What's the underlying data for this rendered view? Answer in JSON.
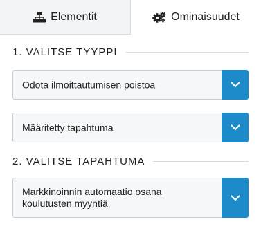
{
  "tabs": [
    {
      "label": "Elementit",
      "icon": "sitemap-icon",
      "active": false
    },
    {
      "label": "Ominaisuudet",
      "icon": "gears-icon",
      "active": true
    }
  ],
  "sections": [
    {
      "title": "1. VALITSE TYYPPI"
    },
    {
      "title": "2. VALITSE TAPAHTUMA"
    }
  ],
  "selects": {
    "type": {
      "value": "Odota ilmoittautumisen poistoa"
    },
    "event_kind": {
      "value": "Määritetty tapahtuma"
    },
    "event": {
      "value": "Markkinoinnin automaatio osana koulutusten myyntiä"
    }
  },
  "colors": {
    "accent": "#1d8bc9",
    "inactive_tab_bg": "#f3f4f5",
    "select_bg": "#f6f7f8"
  }
}
